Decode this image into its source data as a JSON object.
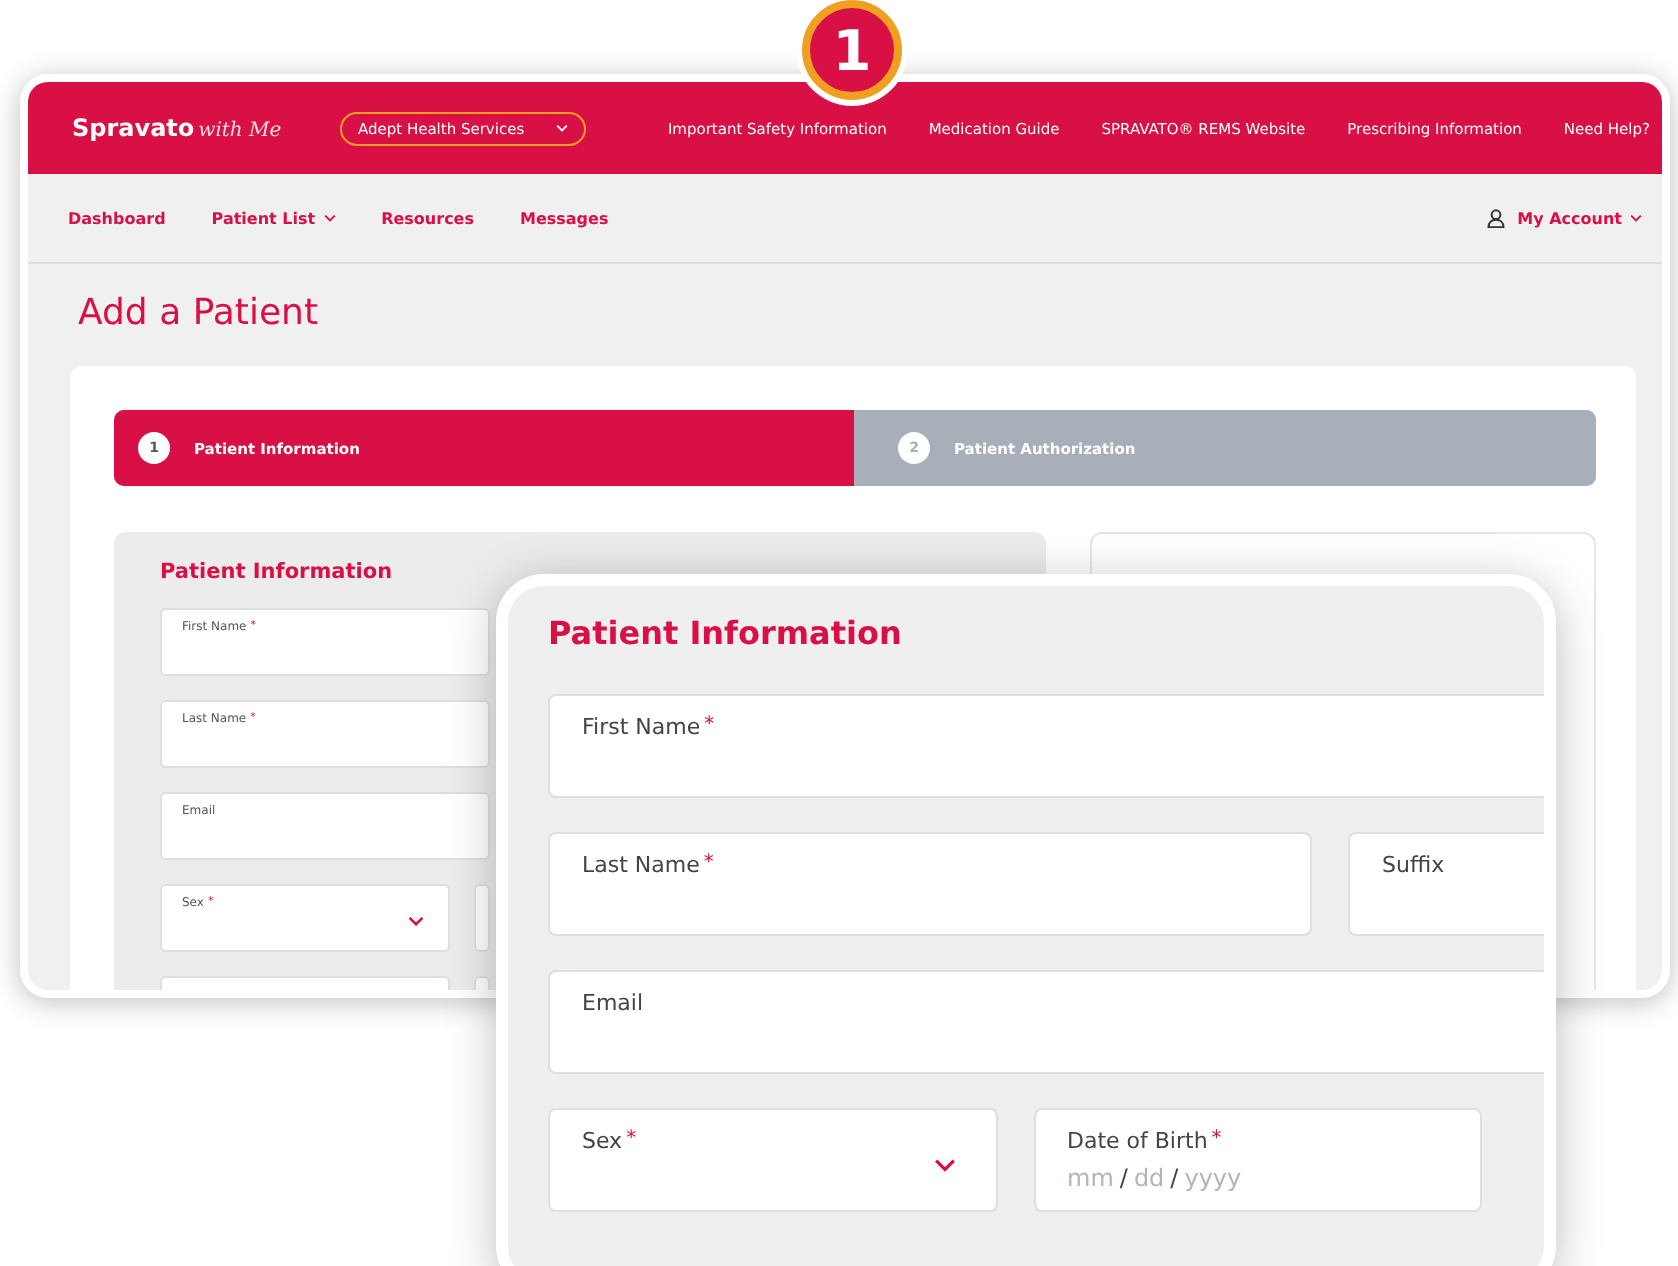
{
  "header": {
    "logo_text": "Spravato",
    "logo_suffix": "with Me",
    "org_select": "Adept Health Services",
    "links": [
      "Important Safety Information",
      "Medication Guide",
      "SPRAVATO® REMS Website",
      "Prescribing Information",
      "Need Help?"
    ]
  },
  "nav": {
    "items": [
      {
        "label": "Dashboard",
        "has_menu": false
      },
      {
        "label": "Patient List",
        "has_menu": true
      },
      {
        "label": "Resources",
        "has_menu": false
      },
      {
        "label": "Messages",
        "has_menu": false
      }
    ],
    "account": "My Account"
  },
  "page_title": "Add a Patient",
  "steps": [
    {
      "number": "1",
      "label": "Patient Information",
      "selected": true
    },
    {
      "number": "2",
      "label": "Patient Authorization",
      "selected": false
    }
  ],
  "form": {
    "title": "Patient Information",
    "rows": [
      [
        {
          "kind": "text",
          "label": "First Name",
          "required_mark": "*"
        }
      ],
      [
        {
          "kind": "text",
          "label": "Last Name",
          "required_mark": "*"
        }
      ],
      [
        {
          "kind": "text",
          "label": "Email"
        }
      ],
      [
        {
          "kind": "select",
          "label": "Sex",
          "required_mark": "*"
        },
        {
          "kind": "text"
        }
      ],
      [
        {
          "kind": "text"
        },
        {
          "kind": "text"
        }
      ]
    ]
  },
  "callout": {
    "badge": "1",
    "title": "Patient Information",
    "rows": [
      [
        {
          "kind": "text",
          "label": "First Name",
          "required_mark": "*"
        }
      ],
      [
        {
          "kind": "text",
          "label": "Last Name",
          "required_mark": "*"
        },
        {
          "kind": "text",
          "label": "Suffix"
        }
      ],
      [
        {
          "kind": "text",
          "label": "Email"
        }
      ],
      [
        {
          "kind": "select",
          "label": "Sex",
          "required_mark": "*"
        },
        {
          "kind": "date",
          "label": "Date of Birth",
          "required_mark": "*",
          "placeholder_parts": [
            "mm",
            "dd",
            "yyyy"
          ],
          "separator": "/"
        }
      ]
    ]
  }
}
